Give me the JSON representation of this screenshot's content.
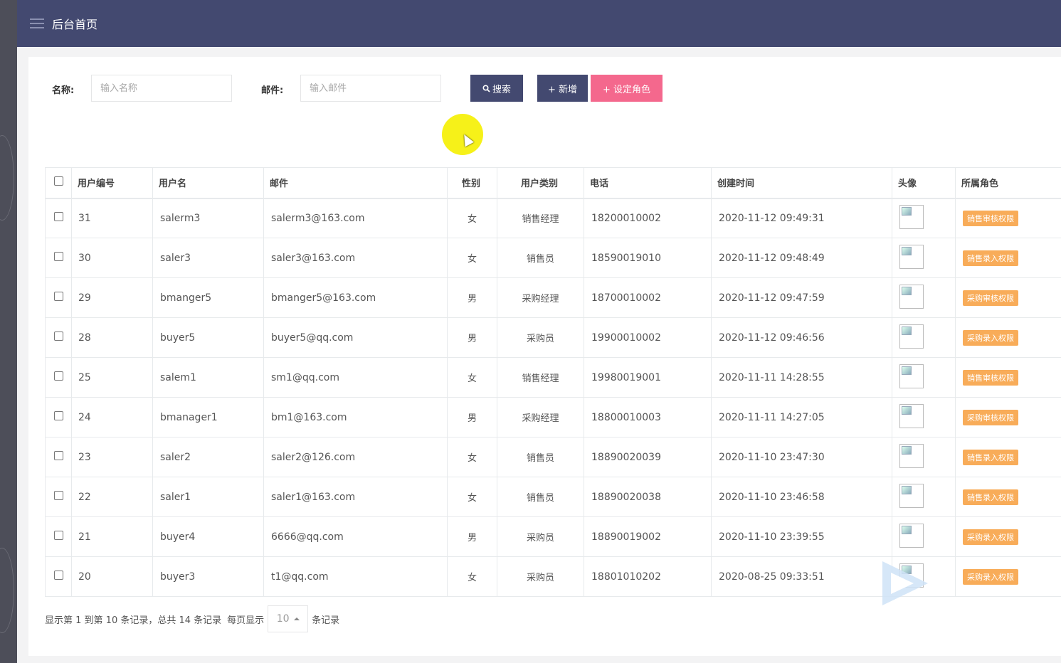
{
  "header": {
    "title": "后台首页"
  },
  "search": {
    "name_label": "名称:",
    "name_placeholder": "输入名称",
    "email_label": "邮件:",
    "email_placeholder": "输入邮件",
    "search_button": "搜索",
    "add_button": "+ 新增",
    "set_role_button": "+ 设定角色"
  },
  "table": {
    "columns": [
      "用户编号",
      "用户名",
      "邮件",
      "性别",
      "用户类别",
      "电话",
      "创建时间",
      "头像",
      "所属角色"
    ],
    "rows": [
      {
        "id": "31",
        "username": "salerm3",
        "email": "salerm3@163.com",
        "gender": "女",
        "type": "销售经理",
        "phone": "18200010002",
        "created": "2020-11-12 09:49:31",
        "role": "销售审核权限"
      },
      {
        "id": "30",
        "username": "saler3",
        "email": "saler3@163.com",
        "gender": "女",
        "type": "销售员",
        "phone": "18590019010",
        "created": "2020-11-12 09:48:49",
        "role": "销售录入权限"
      },
      {
        "id": "29",
        "username": "bmanger5",
        "email": "bmanger5@163.com",
        "gender": "男",
        "type": "采购经理",
        "phone": "18700010002",
        "created": "2020-11-12 09:47:59",
        "role": "采购审核权限"
      },
      {
        "id": "28",
        "username": "buyer5",
        "email": "buyer5@qq.com",
        "gender": "男",
        "type": "采购员",
        "phone": "19900010002",
        "created": "2020-11-12 09:46:56",
        "role": "采购录入权限"
      },
      {
        "id": "25",
        "username": "salem1",
        "email": "sm1@qq.com",
        "gender": "女",
        "type": "销售经理",
        "phone": "19980019001",
        "created": "2020-11-11 14:28:55",
        "role": "销售审核权限"
      },
      {
        "id": "24",
        "username": "bmanager1",
        "email": "bm1@163.com",
        "gender": "男",
        "type": "采购经理",
        "phone": "18800010003",
        "created": "2020-11-11 14:27:05",
        "role": "采购审核权限"
      },
      {
        "id": "23",
        "username": "saler2",
        "email": "saler2@126.com",
        "gender": "女",
        "type": "销售员",
        "phone": "18890020039",
        "created": "2020-11-10 23:47:30",
        "role": "销售录入权限"
      },
      {
        "id": "22",
        "username": "saler1",
        "email": "saler1@163.com",
        "gender": "女",
        "type": "销售员",
        "phone": "18890020038",
        "created": "2020-11-10 23:46:58",
        "role": "销售录入权限"
      },
      {
        "id": "21",
        "username": "buyer4",
        "email": "6666@qq.com",
        "gender": "男",
        "type": "采购员",
        "phone": "18890019002",
        "created": "2020-11-10 23:39:55",
        "role": "采购录入权限"
      },
      {
        "id": "20",
        "username": "buyer3",
        "email": "t1@qq.com",
        "gender": "女",
        "type": "采购员",
        "phone": "18801010202",
        "created": "2020-08-25 09:33:51",
        "role": "采购录入权限"
      }
    ]
  },
  "pagination": {
    "summary": "显示第 1 到第 10 条记录，总共 14 条记录",
    "per_page_label": "每页显示",
    "per_page_value": "10",
    "records_suffix": "条记录"
  },
  "colors": {
    "header_bg": "#434970",
    "primary_button": "#434970",
    "pink_button": "#f4688d",
    "role_badge": "#f8ac59"
  }
}
